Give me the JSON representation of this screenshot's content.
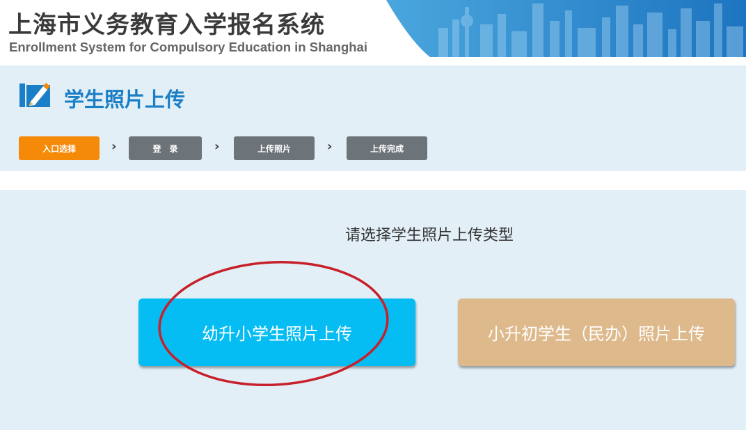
{
  "header": {
    "title": "上海市义务教育入学报名系统",
    "subtitle": "Enrollment System for Compulsory Education in Shanghai"
  },
  "page": {
    "title": "学生照片上传",
    "title_icon": "edit-pencil-icon"
  },
  "steps": [
    {
      "label": "入口选择",
      "state": "active"
    },
    {
      "label": "登　录",
      "state": "inactive"
    },
    {
      "label": "上传照片",
      "state": "inactive"
    },
    {
      "label": "上传完成",
      "state": "inactive"
    }
  ],
  "step_separator_icon": "chevron-right-icon",
  "main": {
    "prompt": "请选择学生照片上传类型",
    "options": [
      {
        "label": "幼升小学生照片上传",
        "color": "#05bdf2"
      },
      {
        "label": "小升初学生（民办）照片上传",
        "color": "#deb98b"
      }
    ]
  },
  "colors": {
    "brand_blue": "#1a7fc6",
    "active_step": "#f58a09",
    "inactive_step": "#6d7479",
    "highlight_circle": "#c8202a"
  }
}
